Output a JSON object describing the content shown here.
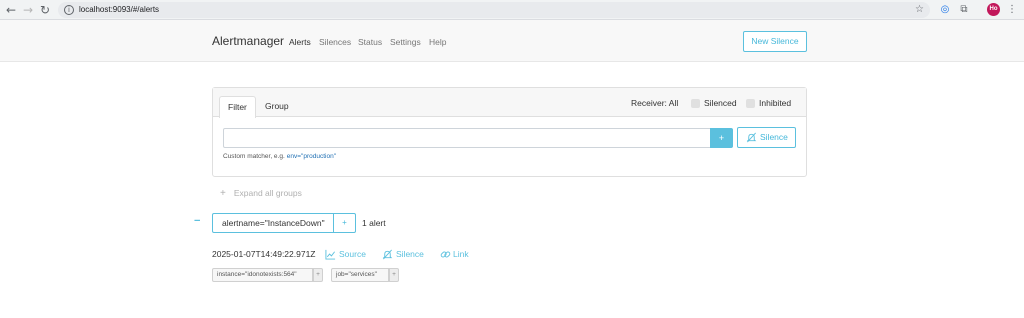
{
  "browser": {
    "url": "localhost:9093/#/alerts",
    "profile_initials": "Ho"
  },
  "navbar": {
    "brand": "Alertmanager",
    "links": [
      "Alerts",
      "Silences",
      "Status",
      "Settings",
      "Help"
    ],
    "active_link": "Alerts",
    "new_silence_label": "New Silence"
  },
  "filter": {
    "tabs": [
      "Filter",
      "Group"
    ],
    "active_tab": "Filter",
    "receiver_label": "Receiver: All",
    "silenced_label": "Silenced",
    "inhibited_label": "Inhibited",
    "input_value": "",
    "add_button_label": "+",
    "silence_button_label": "Silence",
    "hint_text": "Custom matcher, e.g.",
    "hint_example": "env=\"production\""
  },
  "groups": {
    "expand_all_label": "Expand all groups",
    "collapse_symbol": "−",
    "group_label": "alertname=\"InstanceDown\"",
    "group_add_label": "+",
    "count_label": "1 alert",
    "alert": {
      "timestamp": "2025-01-07T14:49:22.971Z",
      "source_label": "Source",
      "silence_label": "Silence",
      "link_label": "Link",
      "labels": [
        "instance=\"idonotexists:564\"",
        "job=\"services\""
      ],
      "label_add": "+"
    }
  },
  "colors": {
    "accent": "#5bc0de",
    "navbar_bg": "#f8f8f8"
  }
}
